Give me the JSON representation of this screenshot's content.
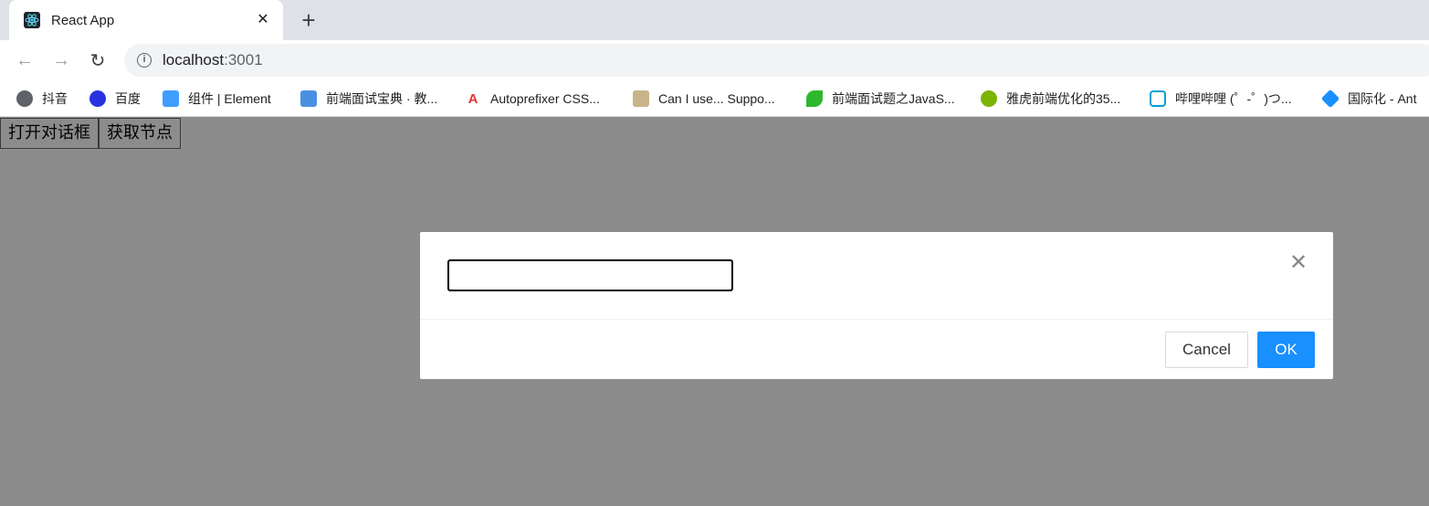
{
  "browser": {
    "tab": {
      "title": "React App",
      "favicon": "react-icon",
      "close": "✕"
    },
    "new_tab": "+",
    "toolbar": {
      "back": "←",
      "forward": "→",
      "reload": "↻",
      "url_host": "localhost",
      "url_port": ":3001",
      "info_icon": "i"
    },
    "bookmarks": [
      {
        "label": "抖音",
        "icon": "globe-icon",
        "color": "#5f6368"
      },
      {
        "label": "百度",
        "icon": "baidu-paw-icon",
        "color": "#2932e1"
      },
      {
        "label": "组件 | Element",
        "icon": "element-icon",
        "color": "#409eff"
      },
      {
        "label": "前端面试宝典 · 教...",
        "icon": "cube-icon",
        "color": "#4a90e2"
      },
      {
        "label": "Autoprefixer CSS...",
        "icon": "autoprefixer-icon",
        "color": "#dd3735"
      },
      {
        "label": "Can I use... Suppo...",
        "icon": "chart-icon",
        "color": "#8a6d3b"
      },
      {
        "label": "前端面试题之JavaS...",
        "icon": "leaf-icon",
        "color": "#2eb82e"
      },
      {
        "label": "雅虎前端优化的35...",
        "icon": "bug-icon",
        "color": "#7cb305"
      },
      {
        "label": "哔哩哔哩 (゜-゜)つ...",
        "icon": "bilibili-icon",
        "color": "#00a1d6"
      },
      {
        "label": "国际化 - Ant",
        "icon": "ant-icon",
        "color": "#1890ff"
      }
    ]
  },
  "page": {
    "open_dialog_button": "打开对话框",
    "get_node_button": "获取节点"
  },
  "modal": {
    "input_value": "",
    "close": "✕",
    "cancel_label": "Cancel",
    "ok_label": "OK"
  }
}
